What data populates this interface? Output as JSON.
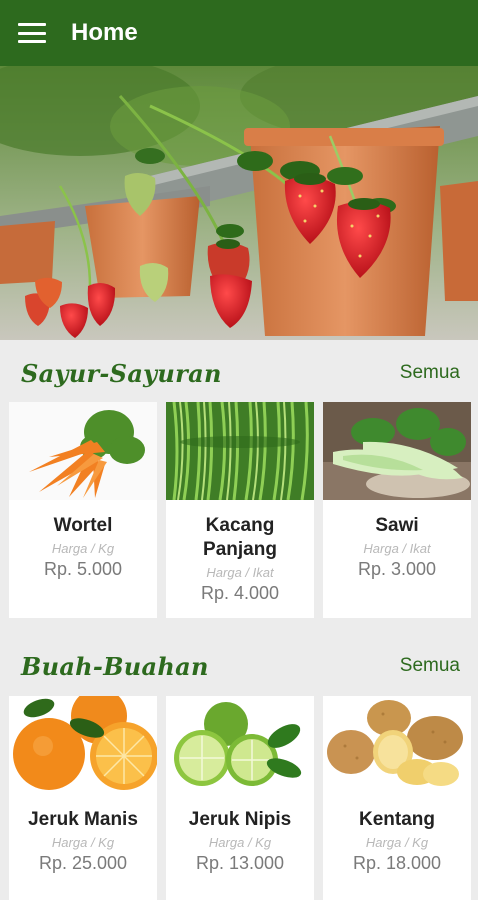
{
  "app_bar": {
    "title": "Home",
    "menu_icon": "hamburger-menu-icon"
  },
  "banner": {
    "image": "strawberry-plants-in-pots-photo"
  },
  "sections": [
    {
      "title": "Sayur-Sayuran",
      "see_all": "Semua",
      "products": [
        {
          "name": "Wortel",
          "unit": "Harga / Kg",
          "price": "Rp. 5.000",
          "image": "carrots-photo"
        },
        {
          "name": "Kacang Panjang",
          "unit": "Harga / Ikat",
          "price": "Rp. 4.000",
          "image": "long-beans-photo"
        },
        {
          "name": "Sawi",
          "unit": "Harga / Ikat",
          "price": "Rp. 3.000",
          "image": "bok-choy-photo"
        }
      ]
    },
    {
      "title": "Buah-Buahan",
      "see_all": "Semua",
      "products": [
        {
          "name": "Jeruk Manis",
          "unit": "Harga / Kg",
          "price": "Rp. 25.000",
          "image": "oranges-photo"
        },
        {
          "name": "Jeruk Nipis",
          "unit": "Harga / Kg",
          "price": "Rp. 13.000",
          "image": "limes-photo"
        },
        {
          "name": "Kentang",
          "unit": "Harga / Kg",
          "price": "Rp. 18.000",
          "image": "potatoes-photo"
        }
      ]
    }
  ],
  "colors": {
    "primary": "#2d6a1e",
    "background": "#ececec",
    "card": "#ffffff",
    "unit_text": "#b8b8b8",
    "price_text": "#7a7a7a"
  }
}
